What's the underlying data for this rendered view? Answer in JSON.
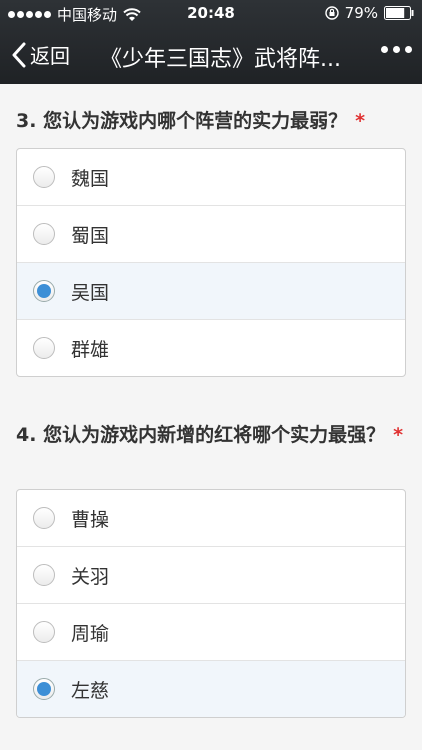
{
  "status": {
    "carrier": "中国移动",
    "time": "20:48",
    "battery": "79%",
    "battery_level": 0.79
  },
  "nav": {
    "back_label": "返回",
    "title": "《少年三国志》武将阵..."
  },
  "questions": [
    {
      "number": "3.",
      "text": "您认为游戏内哪个阵营的实力最弱？",
      "required_mark": "*",
      "options": [
        {
          "label": "魏国",
          "selected": false
        },
        {
          "label": "蜀国",
          "selected": false
        },
        {
          "label": "吴国",
          "selected": true
        },
        {
          "label": "群雄",
          "selected": false
        }
      ]
    },
    {
      "number": "4.",
      "text": "您认为游戏内新增的红将哪个实力最强？",
      "required_mark": "*",
      "options": [
        {
          "label": "曹操",
          "selected": false
        },
        {
          "label": "关羽",
          "selected": false
        },
        {
          "label": "周瑜",
          "selected": false
        },
        {
          "label": "左慈",
          "selected": true
        }
      ]
    }
  ]
}
